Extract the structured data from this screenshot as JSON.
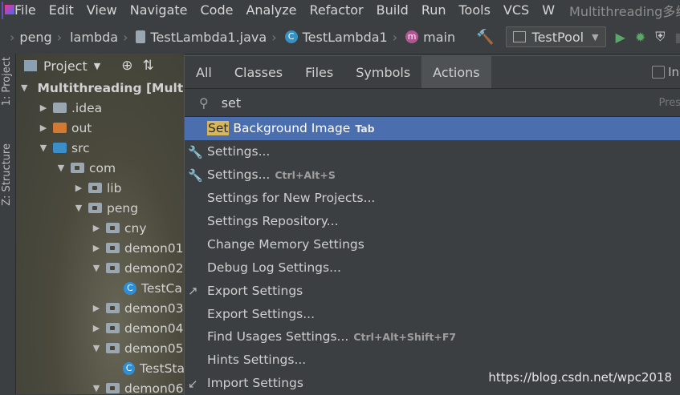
{
  "menubar": {
    "items": [
      "File",
      "Edit",
      "View",
      "Navigate",
      "Code",
      "Analyze",
      "Refactor",
      "Build",
      "Run",
      "Tools",
      "VCS",
      "W"
    ],
    "title": "Multithreading多线’"
  },
  "breadcrumbs": [
    {
      "icon": "folder-icon",
      "label": "peng"
    },
    {
      "icon": "folder-icon",
      "label": "lambda"
    },
    {
      "icon": "java-file-icon",
      "label": "TestLambda1.java"
    },
    {
      "icon": "class-icon",
      "label": "TestLambda1"
    },
    {
      "icon": "method-icon",
      "label": "main"
    }
  ],
  "toolbar": {
    "run_config": "TestPool"
  },
  "toolstrip": {
    "project_tab": "1: Project",
    "structure_tab": "Z: Structure"
  },
  "project_panel": {
    "title": "Project",
    "tree": [
      {
        "label": "Multithreading [Multit",
        "depth": 0,
        "arrow": "down",
        "icon": "module"
      },
      {
        "label": ".idea",
        "depth": 1,
        "arrow": "right",
        "icon": "folder"
      },
      {
        "label": "out",
        "depth": 1,
        "arrow": "right",
        "icon": "folder-orange"
      },
      {
        "label": "src",
        "depth": 1,
        "arrow": "down",
        "icon": "folder-blue"
      },
      {
        "label": "com",
        "depth": 2,
        "arrow": "down",
        "icon": "package"
      },
      {
        "label": "lib",
        "depth": 3,
        "arrow": "right",
        "icon": "package"
      },
      {
        "label": "peng",
        "depth": 3,
        "arrow": "down",
        "icon": "package"
      },
      {
        "label": "cny",
        "depth": 4,
        "arrow": "right",
        "icon": "package"
      },
      {
        "label": "demon01",
        "depth": 4,
        "arrow": "right",
        "icon": "package"
      },
      {
        "label": "demon02",
        "depth": 4,
        "arrow": "down",
        "icon": "package"
      },
      {
        "label": "TestCa",
        "depth": 5,
        "arrow": "",
        "icon": "class"
      },
      {
        "label": "demon03",
        "depth": 4,
        "arrow": "right",
        "icon": "package"
      },
      {
        "label": "demon04",
        "depth": 4,
        "arrow": "right",
        "icon": "package"
      },
      {
        "label": "demon05",
        "depth": 4,
        "arrow": "down",
        "icon": "package"
      },
      {
        "label": "TestSta",
        "depth": 5,
        "arrow": "",
        "icon": "class"
      },
      {
        "label": "demon06",
        "depth": 4,
        "arrow": "down",
        "icon": "package"
      }
    ]
  },
  "popup": {
    "tabs": [
      "All",
      "Classes",
      "Files",
      "Symbols",
      "Actions"
    ],
    "active_tab": "Actions",
    "checkbox_label": "In",
    "search_value": "set",
    "search_hint": "Pres",
    "results": [
      {
        "highlight": "Set",
        "text": " Background Image",
        "shortcut": "Tab",
        "icon": "",
        "selected": true
      },
      {
        "highlight": "",
        "text": "Settings...",
        "shortcut": "",
        "icon": "wrench"
      },
      {
        "highlight": "",
        "text": "Settings...",
        "shortcut": "Ctrl+Alt+S",
        "icon": "wrench"
      },
      {
        "highlight": "",
        "text": "Settings for New Projects...",
        "shortcut": "",
        "icon": ""
      },
      {
        "highlight": "",
        "text": "Settings Repository...",
        "shortcut": "",
        "icon": ""
      },
      {
        "highlight": "",
        "text": "Change Memory Settings",
        "shortcut": "",
        "icon": ""
      },
      {
        "highlight": "",
        "text": "Debug Log Settings...",
        "shortcut": "",
        "icon": ""
      },
      {
        "highlight": "",
        "text": "Export Settings",
        "shortcut": "",
        "icon": "export"
      },
      {
        "highlight": "",
        "text": "Export Settings...",
        "shortcut": "",
        "icon": ""
      },
      {
        "highlight": "",
        "text": "Find Usages Settings...",
        "shortcut": "Ctrl+Alt+Shift+F7",
        "icon": ""
      },
      {
        "highlight": "",
        "text": "Hints Settings...",
        "shortcut": "",
        "icon": ""
      },
      {
        "highlight": "",
        "text": "Import Settings",
        "shortcut": "",
        "icon": "import"
      }
    ]
  },
  "watermark": "https://blog.csdn.net/wpc2018"
}
